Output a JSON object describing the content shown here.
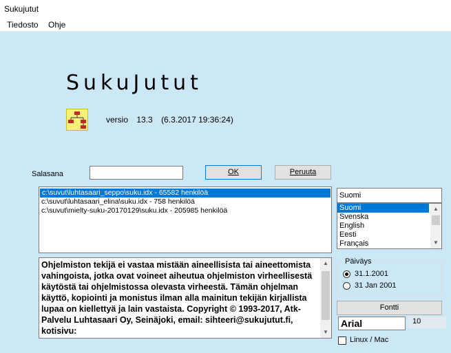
{
  "window": {
    "title": "Sukujutut"
  },
  "menu": {
    "file": "Tiedosto",
    "help": "Ohje"
  },
  "app": {
    "logo": "SukuJutut",
    "version_label": "versio",
    "version_number": "13.3",
    "version_date": "(6.3.2017 19:36:24)"
  },
  "login": {
    "password_label": "Salasana",
    "password_value": "",
    "ok_button": "OK",
    "cancel_button": "Peruuta"
  },
  "databases": [
    {
      "path": "c:\\suvut\\luhtasaari_seppo\\suku.idx - 65582 henkilöä",
      "selected": true
    },
    {
      "path": "c:\\suvut\\luhtasaari_elina\\suku.idx - 758 henkilöä",
      "selected": false
    },
    {
      "path": "c:\\suvut\\mielty-suku-20170129\\suku.idx - 205985 henkilöä",
      "selected": false
    }
  ],
  "language": {
    "current": "Suomi",
    "options": [
      "Suomi",
      "Svenska",
      "English",
      "Eesti",
      "Français"
    ]
  },
  "disclaimer": {
    "text": "Ohjelmiston tekijä ei vastaa mistään aineellisista tai aineettomista vahingoista, jotka ovat voineet aiheutua ohjelmiston virheellisestä käytöstä tai ohjelmistossa olevasta virheestä. Tämän ohjelman käyttö, kopiointi ja monistus ilman alla mainitun tekijän kirjallista lupaa on kiellettyä ja lain vastaista. Copyright © 1993-2017, Atk-Palvelu Luhtasaari Oy, Seinäjoki, email: sihteeri@sukujutut.fi, kotisivu:"
  },
  "date_format": {
    "title": "Päiväys",
    "option1": "31.1.2001",
    "option2": "31 Jan 2001",
    "selected": "option1"
  },
  "font": {
    "button": "Fontti",
    "name": "Arial",
    "size": "10"
  },
  "linux_mac": {
    "label": "Linux / Mac",
    "checked": false
  },
  "colors": {
    "background": "#cce8f6",
    "selection": "#0078d7"
  }
}
